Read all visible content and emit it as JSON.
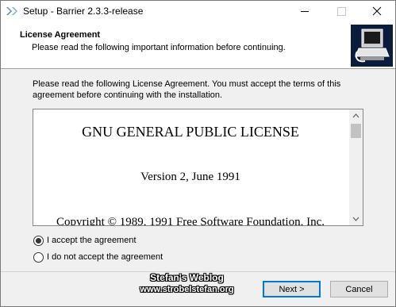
{
  "window": {
    "title": "Setup - Barrier 2.3.3-release"
  },
  "header": {
    "title": "License Agreement",
    "subtitle": "Please read the following important information before continuing."
  },
  "instructions": "Please read the following License Agreement. You must accept the terms of this agreement before continuing with the installation.",
  "license": {
    "heading": "GNU GENERAL PUBLIC LICENSE",
    "version": "Version 2, June 1991",
    "copyright": "Copyright © 1989, 1991 Free Software Foundation, Inc."
  },
  "options": {
    "accept_label": "I accept the agreement",
    "decline_label": "I do not accept the agreement",
    "selected": "accept"
  },
  "watermark": {
    "line1": "Stefan's Weblog",
    "line2": "www.strobelstefan.org"
  },
  "buttons": {
    "next_label": "Next >",
    "cancel_label": "Cancel"
  },
  "colors": {
    "logo_bg": "#0b1b3c",
    "focus_border": "#0078d7"
  },
  "icons": {
    "app": "barrier-app-icon",
    "logo": "computer-installer-icon"
  }
}
